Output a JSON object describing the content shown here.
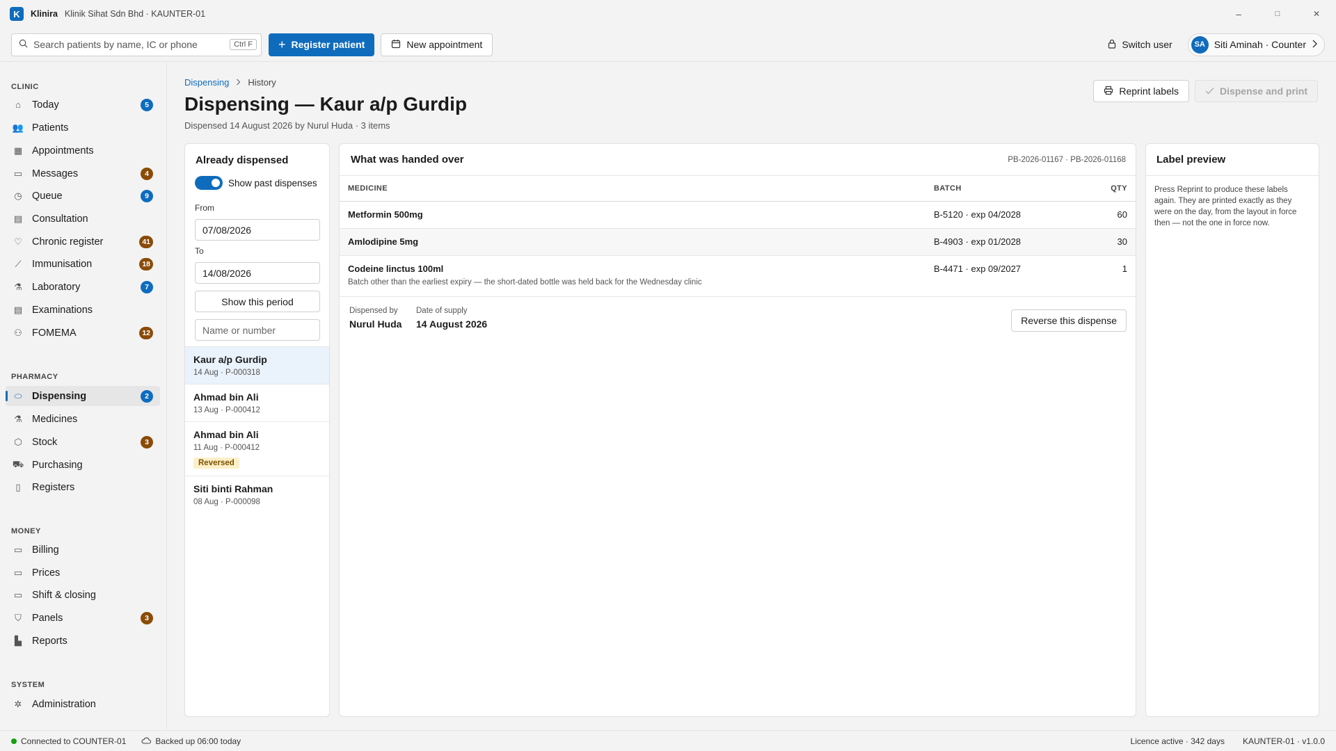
{
  "app": {
    "logo_letter": "K",
    "name": "Klinira",
    "subtitle": "Klinik Sihat Sdn Bhd · KAUNTER-01",
    "window_controls": [
      "–",
      "□",
      "✕"
    ]
  },
  "toolbar": {
    "search_placeholder": "Search patients by name, IC or phone",
    "search_shortcut": "Ctrl F",
    "register_label": "Register patient",
    "new_appointment_label": "New appointment",
    "switch_user_label": "Switch user",
    "user_initials": "SA",
    "user_name": "Siti Aminah · Counter"
  },
  "sidebar": {
    "sections": {
      "clinic": "CLINIC",
      "pharmacy": "PHARMACY",
      "money": "MONEY",
      "system": "SYSTEM"
    },
    "items": [
      {
        "label": "Today",
        "icon": "home-icon",
        "badge": "5",
        "badge_color": "#0f6cbd"
      },
      {
        "label": "Patients",
        "icon": "people-icon",
        "badge": null
      },
      {
        "label": "Appointments",
        "icon": "calendar-icon",
        "badge": null
      },
      {
        "label": "Messages",
        "icon": "chat-icon",
        "badge": "4",
        "badge_color": "#8a4b08"
      },
      {
        "label": "Queue",
        "icon": "clock-icon",
        "badge": "9",
        "badge_color": "#0f6cbd"
      },
      {
        "label": "Consultation",
        "icon": "document-icon",
        "badge": null
      },
      {
        "label": "Chronic register",
        "icon": "heart-icon",
        "badge": "41",
        "badge_color": "#8a4b08"
      },
      {
        "label": "Immunisation",
        "icon": "syringe-icon",
        "badge": "18",
        "badge_color": "#8a4b08"
      },
      {
        "label": "Laboratory",
        "icon": "flask-icon",
        "badge": "7",
        "badge_color": "#0f6cbd"
      },
      {
        "label": "Examinations",
        "icon": "clipboard-icon",
        "badge": null
      },
      {
        "label": "FOMEMA",
        "icon": "person-icon",
        "badge": "12",
        "badge_color": "#8a4b08"
      },
      {
        "label": "Dispensing",
        "icon": "pill-icon",
        "badge": "2",
        "badge_color": "#0f6cbd",
        "active": true
      },
      {
        "label": "Medicines",
        "icon": "flask-icon",
        "badge": null
      },
      {
        "label": "Stock",
        "icon": "box-icon",
        "badge": "3",
        "badge_color": "#8a4b08"
      },
      {
        "label": "Purchasing",
        "icon": "cart-icon",
        "badge": null
      },
      {
        "label": "Registers",
        "icon": "book-icon",
        "badge": null
      },
      {
        "label": "Billing",
        "icon": "money-icon",
        "badge": null
      },
      {
        "label": "Prices",
        "icon": "tag-icon",
        "badge": null
      },
      {
        "label": "Shift & closing",
        "icon": "cash-drawer-icon",
        "badge": null
      },
      {
        "label": "Panels",
        "icon": "shield-icon",
        "badge": "3",
        "badge_color": "#8a4b08"
      },
      {
        "label": "Reports",
        "icon": "bar-chart-icon",
        "badge": null
      },
      {
        "label": "Administration",
        "icon": "gear-icon",
        "badge": null
      }
    ]
  },
  "page": {
    "breadcrumb": [
      "Dispensing",
      "History"
    ],
    "title": "Dispensing — Kaur a/p Gurdip",
    "subtitle": "Dispensed 14 August 2026 by Nurul Huda · 3 items",
    "reprint_label": "Reprint labels",
    "dispense_label": "Dispense and print"
  },
  "filter": {
    "title": "Already dispensed",
    "toggle_label": "Show past dispenses",
    "toggle_on": true,
    "from_label": "From",
    "from_value": "07/08/2026",
    "to_label": "To",
    "to_value": "14/08/2026",
    "show_period_label": "Show this period",
    "name_placeholder": "Name or number",
    "history": [
      {
        "name": "Kaur a/p Gurdip",
        "meta": "14 Aug · P-000318",
        "selected": true,
        "tag": null
      },
      {
        "name": "Ahmad bin Ali",
        "meta": "13 Aug · P-000412",
        "selected": false,
        "tag": null
      },
      {
        "name": "Ahmad bin Ali",
        "meta": "11 Aug · P-000412",
        "selected": false,
        "tag": "Reversed"
      },
      {
        "name": "Siti binti Rahman",
        "meta": "08 Aug · P-000098",
        "selected": false,
        "tag": null
      }
    ]
  },
  "handover": {
    "title": "What was handed over",
    "refs": "PB-2026-01167 · PB-2026-01168",
    "columns": [
      "MEDICINE",
      "BATCH",
      "QTY"
    ],
    "rows": [
      {
        "medicine": "Metformin 500mg",
        "note": "",
        "batch": "B-5120 · exp 04/2028",
        "qty": "60"
      },
      {
        "medicine": "Amlodipine 5mg",
        "note": "",
        "batch": "B-4903 · exp 01/2028",
        "qty": "30"
      },
      {
        "medicine": "Codeine linctus 100ml",
        "note": "Batch other than the earliest expiry — the short-dated bottle was held back for the Wednesday clinic",
        "batch": "B-4471 · exp 09/2027",
        "qty": "1"
      }
    ],
    "dispensed_by_label": "Dispensed by",
    "dispensed_by": "Nurul Huda",
    "date_label": "Date of supply",
    "date": "14 August 2026",
    "reverse_label": "Reverse this dispense"
  },
  "label_preview": {
    "title": "Label preview",
    "text": "Press Reprint to produce these labels again. They are printed exactly as they were on the day, from the layout in force then — not the one in force now."
  },
  "status": {
    "connection": "Connected to COUNTER-01",
    "backup": "Backed up 06:00 today",
    "licence": "Licence active · 342 days",
    "version": "KAUNTER-01 · v1.0.0"
  }
}
